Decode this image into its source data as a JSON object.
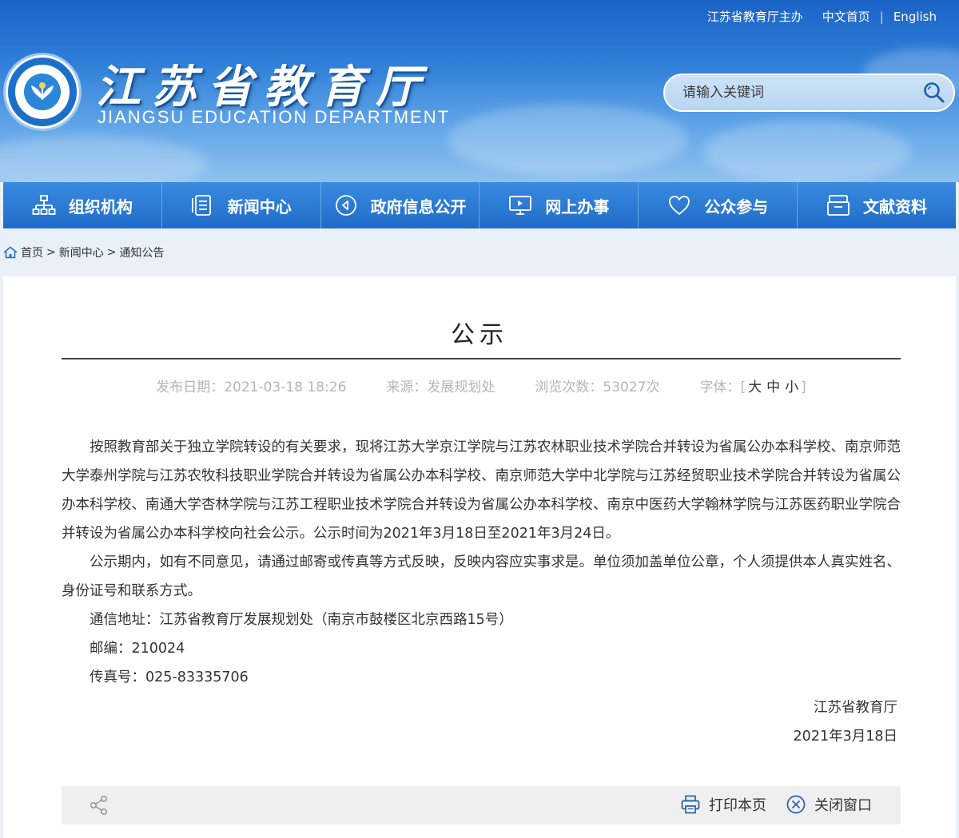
{
  "top_links": {
    "host": "江苏省教育厅主办",
    "home_cn": "中文首页",
    "separator": "|",
    "english": "English"
  },
  "site": {
    "title": "江苏省教育厅",
    "subtitle": "JIANGSU EDUCATION DEPARTMENT"
  },
  "search": {
    "placeholder": "请输入关键词"
  },
  "nav": [
    {
      "label": "组织机构",
      "icon": "org-chart-icon"
    },
    {
      "label": "新闻中心",
      "icon": "document-icon"
    },
    {
      "label": "政府信息公开",
      "icon": "broadcast-icon"
    },
    {
      "label": "网上办事",
      "icon": "monitor-icon"
    },
    {
      "label": "公众参与",
      "icon": "heart-icon"
    },
    {
      "label": "文献资料",
      "icon": "archive-icon"
    }
  ],
  "breadcrumb": {
    "home": "首页",
    "sep": ">",
    "news": "新闻中心",
    "notice": "通知公告"
  },
  "article": {
    "title": "公示",
    "meta": {
      "date": "发布日期：2021-03-18 18:26",
      "source": "来源：发展规划处",
      "views": "浏览次数：53027次",
      "font_label": "字体：[",
      "font_large": "大",
      "font_medium": "中",
      "font_small": "小",
      "font_close": "]"
    },
    "paragraphs": [
      "按照教育部关于独立学院转设的有关要求，现将江苏大学京江学院与江苏农林职业技术学院合并转设为省属公办本科学校、南京师范大学泰州学院与江苏农牧科技职业学院合并转设为省属公办本科学校、南京师范大学中北学院与江苏经贸职业技术学院合并转设为省属公办本科学校、南通大学杏林学院与江苏工程职业技术学院合并转设为省属公办本科学校、南京中医药大学翰林学院与江苏医药职业学院合并转设为省属公办本科学校向社会公示。公示时间为2021年3月18日至2021年3月24日。",
      "公示期内，如有不同意见，请通过邮寄或传真等方式反映，反映内容应实事求是。单位须加盖单位公章，个人须提供本人真实姓名、身份证号和联系方式。",
      "通信地址：江苏省教育厅发展规划处（南京市鼓楼区北京西路15号）",
      "邮编：210024",
      "传真号：025-83335706"
    ],
    "sign_org": "江苏省教育厅",
    "sign_date": "2021年3月18日"
  },
  "toolbar": {
    "print": "打印本页",
    "close": "关闭窗口"
  },
  "colors": {
    "header_top": "#1a63c6",
    "nav_blue": "#1f6cc8",
    "page_bg": "#e9f0f8",
    "meta_gray": "#b5b5b5"
  }
}
